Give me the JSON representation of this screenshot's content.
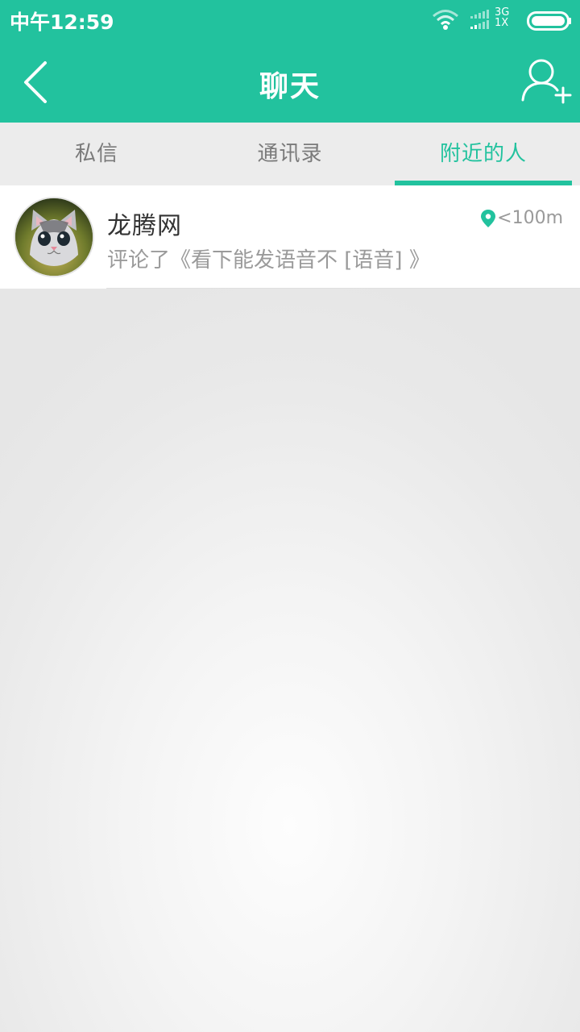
{
  "status_bar": {
    "time": "中午12:59",
    "network_type": "3G",
    "network_speed": "1X",
    "icons": [
      "wifi-icon",
      "signal-icon",
      "battery-icon"
    ]
  },
  "header": {
    "title": "聊天",
    "back_icon": "chevron-left-icon",
    "add_icon": "add-user-icon"
  },
  "tabs": [
    {
      "label": "私信",
      "active": false
    },
    {
      "label": "通讯录",
      "active": false
    },
    {
      "label": "附近的人",
      "active": true
    }
  ],
  "nearby": [
    {
      "name": "龙腾网",
      "distance": "<100m",
      "message": "评论了《看下能发语音不 [语音] 》"
    }
  ],
  "colors": {
    "accent": "#22c29e",
    "tab_inactive": "#7a7a7a",
    "secondary_text": "#9a9a9a"
  }
}
